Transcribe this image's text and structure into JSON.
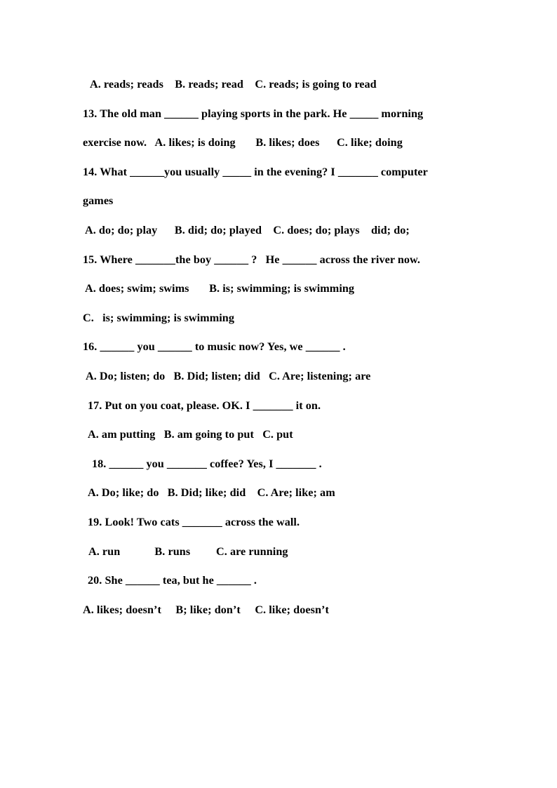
{
  "document": {
    "page_background": "#ffffff",
    "text_color": "#000000",
    "lines": [
      {
        "id": "q12-options",
        "kind": "options",
        "indent": 10,
        "text": "A. reads; reads    B. reads; read    C. reads; is going to read"
      },
      {
        "id": "q13-stem-line1",
        "kind": "question-stem",
        "indent": 0,
        "text": "13. The old man ______ playing sports in the park. He _____ morning"
      },
      {
        "id": "q13-stem-line2-options",
        "kind": "question-continuation-with-options",
        "indent": 0,
        "text": "exercise now.   A. likes; is doing       B. likes; does      C. like; doing"
      },
      {
        "id": "q14-stem-line1",
        "kind": "question-stem",
        "indent": 0,
        "text": "14. What ______you usually _____ in the evening? I _______ computer"
      },
      {
        "id": "q14-stem-line2",
        "kind": "question-continuation",
        "indent": 0,
        "text": "games"
      },
      {
        "id": "q14-options",
        "kind": "options",
        "indent": 3,
        "text": "A. do; do; play      B. did; do; played    C. does; do; plays    did; do;"
      },
      {
        "id": "q15-stem",
        "kind": "question-stem",
        "indent": 0,
        "text": "15. Where _______the boy ______ ?   He ______ across the river now."
      },
      {
        "id": "q15-options-ab",
        "kind": "options",
        "indent": 3,
        "text": "A. does; swim; swims       B. is; swimming; is swimming"
      },
      {
        "id": "q15-options-c",
        "kind": "options",
        "indent": 0,
        "text": "C.   is; swimming; is swimming"
      },
      {
        "id": "q16-stem",
        "kind": "question-stem",
        "indent": 0,
        "text": "16. ______ you ______ to music now? Yes, we ______ ."
      },
      {
        "id": "q16-options",
        "kind": "options",
        "indent": 4,
        "text": "A. Do; listen; do   B. Did; listen; did   C. Are; listening; are"
      },
      {
        "id": "q17-stem",
        "kind": "question-stem",
        "indent": 7,
        "text": "17. Put on you coat, please. OK. I _______ it on."
      },
      {
        "id": "q17-options",
        "kind": "options",
        "indent": 7,
        "text": "A. am putting   B. am going to put   C. put"
      },
      {
        "id": "q18-stem",
        "kind": "question-stem",
        "indent": 13,
        "text": "18. ______ you _______ coffee? Yes, I _______ ."
      },
      {
        "id": "q18-options",
        "kind": "options",
        "indent": 7,
        "text": "A. Do; like; do   B. Did; like; did    C. Are; like; am"
      },
      {
        "id": "q19-stem",
        "kind": "question-stem",
        "indent": 7,
        "text": "19. Look! Two cats _______ across the wall."
      },
      {
        "id": "q19-options",
        "kind": "options",
        "indent": 8,
        "text": "A. run            B. runs         C. are running"
      },
      {
        "id": "q20-stem",
        "kind": "question-stem",
        "indent": 7,
        "text": "20. She ______ tea, but he ______ ."
      },
      {
        "id": "q20-options",
        "kind": "options",
        "indent": 0,
        "text": "A. likes; doesn’t     B; like; don’t     C. like; doesn’t"
      }
    ]
  }
}
